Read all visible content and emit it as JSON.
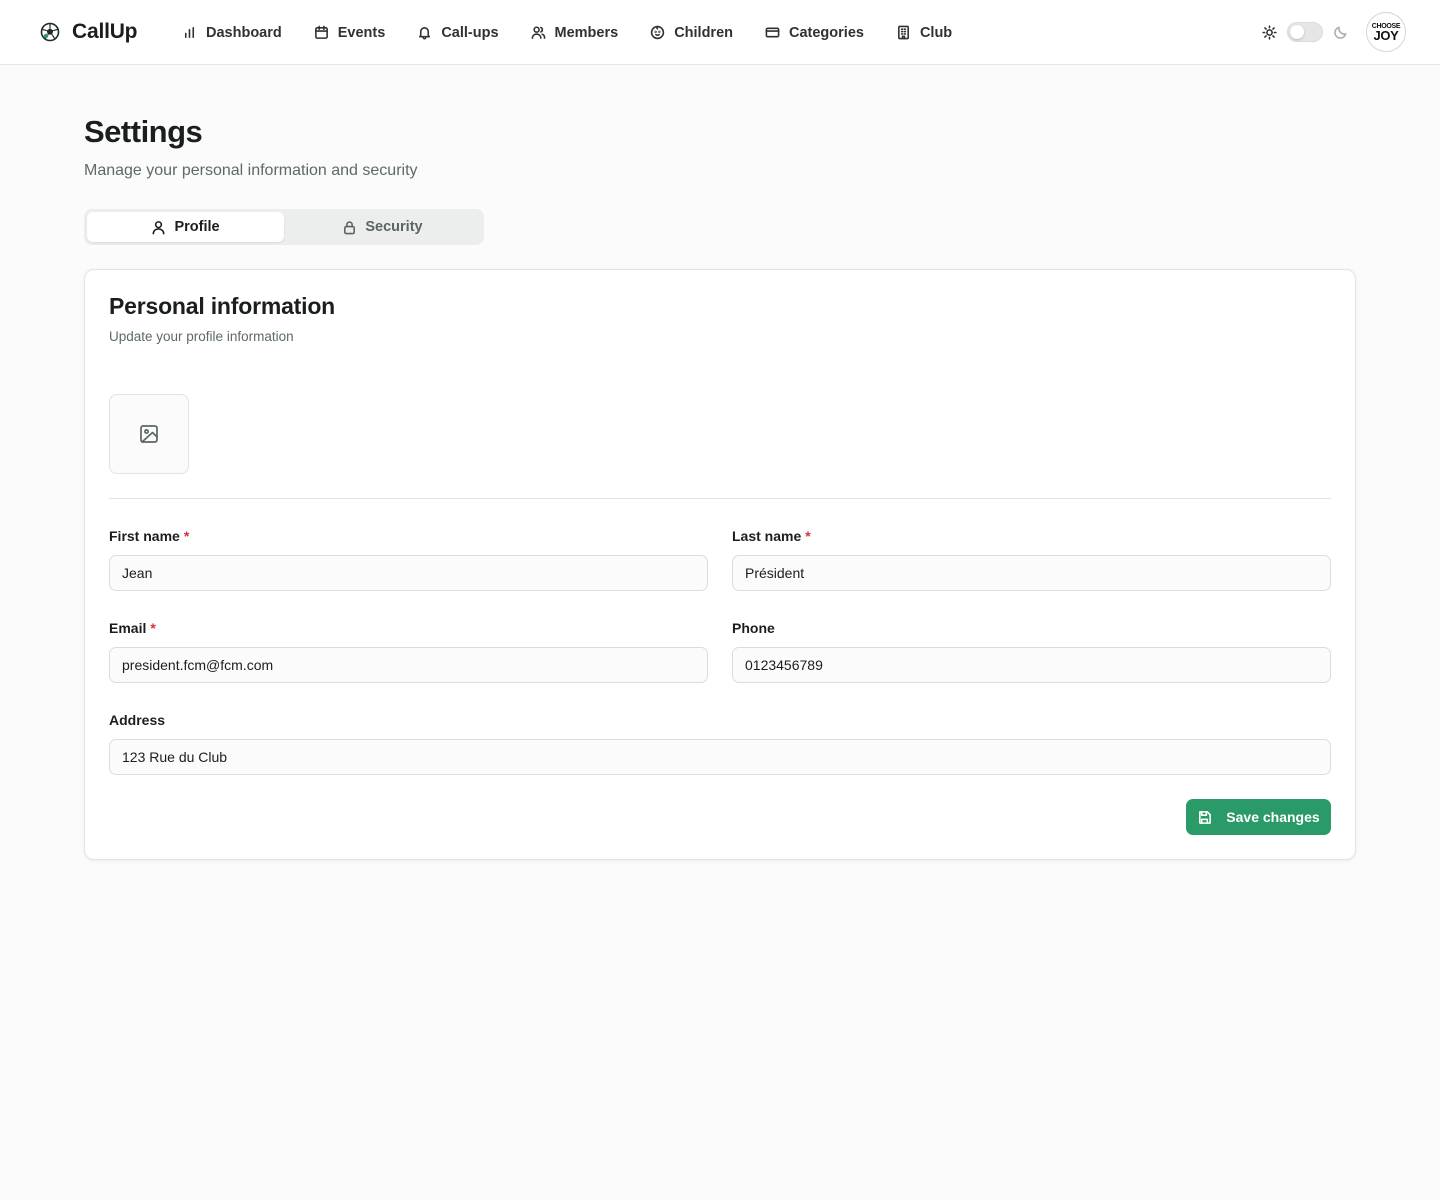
{
  "app": {
    "name": "CallUp",
    "logo_icon": "soccer-ball-icon"
  },
  "nav": {
    "items": [
      {
        "label": "Dashboard",
        "icon": "bar-chart-icon"
      },
      {
        "label": "Events",
        "icon": "calendar-icon"
      },
      {
        "label": "Call-ups",
        "icon": "bell-icon"
      },
      {
        "label": "Members",
        "icon": "users-icon"
      },
      {
        "label": "Children",
        "icon": "baby-icon"
      },
      {
        "label": "Categories",
        "icon": "card-icon"
      },
      {
        "label": "Club",
        "icon": "building-icon"
      }
    ]
  },
  "theme": {
    "light_icon": "sun-icon",
    "dark_icon": "moon-icon",
    "dark_mode": false
  },
  "avatar": {
    "line1": "CHOOSE",
    "line2": "JOY"
  },
  "page": {
    "title": "Settings",
    "subtitle": "Manage your personal information and security"
  },
  "tabs": [
    {
      "label": "Profile",
      "icon": "user-icon",
      "active": true
    },
    {
      "label": "Security",
      "icon": "lock-icon",
      "active": false
    }
  ],
  "card": {
    "title": "Personal information",
    "subtitle": "Update your profile information",
    "photo_icon": "image-icon"
  },
  "form": {
    "first_name": {
      "label": "First name",
      "required_mark": "*",
      "value": "Jean"
    },
    "last_name": {
      "label": "Last name",
      "required_mark": "*",
      "value": "Président"
    },
    "email": {
      "label": "Email",
      "required_mark": "*",
      "value": "president.fcm@fcm.com"
    },
    "phone": {
      "label": "Phone",
      "value": "0123456789"
    },
    "address": {
      "label": "Address",
      "value": "123 Rue du Club"
    }
  },
  "actions": {
    "save_label": "Save changes",
    "save_icon": "save-icon"
  },
  "colors": {
    "accent": "#2a9a68",
    "required": "#d4323c",
    "background": "#fbfbfb"
  }
}
